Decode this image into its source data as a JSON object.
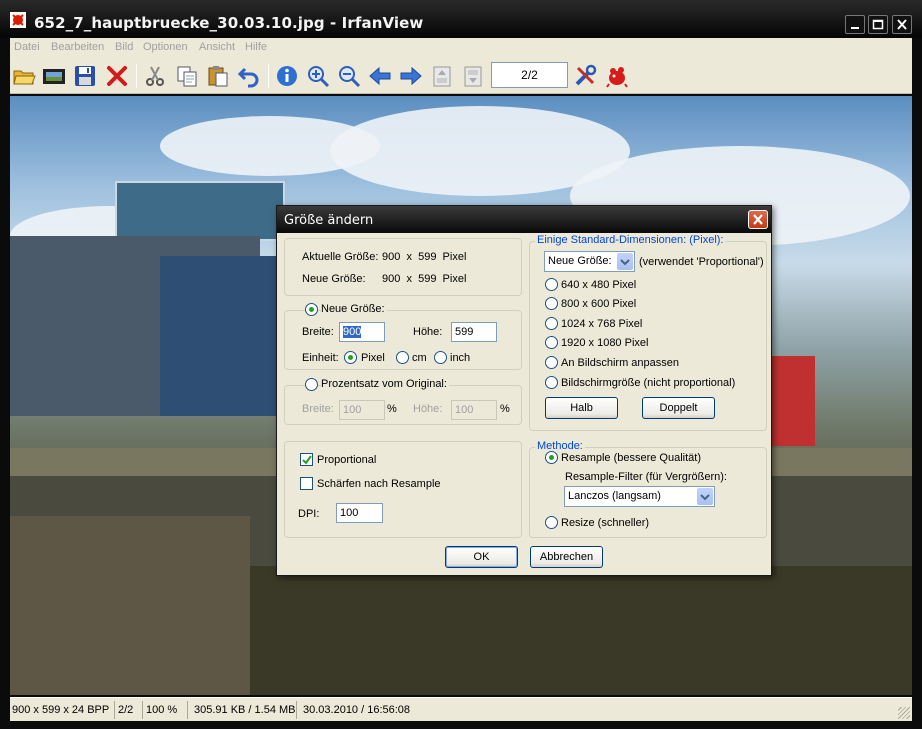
{
  "window": {
    "title": "652_7_hauptbruecke_30.03.10.jpg - IrfanView"
  },
  "menu": [
    "Datei",
    "Bearbeiten",
    "Bild",
    "Optionen",
    "Ansicht",
    "Hilfe"
  ],
  "toolbar": {
    "page_value": "2/2"
  },
  "status": {
    "dimensions": "900 x 599 x 24 BPP",
    "page": "2/2",
    "zoom": "100 %",
    "size": "305.91 KB / 1.54 MB",
    "datetime": "30.03.2010 / 16:56:08"
  },
  "dialog": {
    "title": "Größe ändern",
    "current_size_label": "Aktuelle Größe:",
    "current_size_value": "900  x  599  Pixel",
    "new_size_label": "Neue Größe:",
    "new_size_value": "900  x  599  Pixel",
    "new_size_radio": "Neue Größe:",
    "width_label": "Breite:",
    "width_value": "900",
    "height_label": "Höhe:",
    "height_value": "599",
    "unit_label": "Einheit:",
    "unit_pixel": "Pixel",
    "unit_cm": "cm",
    "unit_inch": "inch",
    "percent_radio": "Prozentsatz vom Original:",
    "pct_width_label": "Breite:",
    "pct_width_value": "100",
    "pct_height_label": "Höhe:",
    "pct_height_value": "100",
    "pct_symbol": "%",
    "proportional": "Proportional",
    "sharpen": "Schärfen nach Resample",
    "dpi_label": "DPI:",
    "dpi_value": "100",
    "std_group": "Einige Standard-Dimensionen: (Pixel):",
    "std_combo": "Neue Größe:",
    "std_combo_note": "(verwendet 'Proportional')",
    "std_options": [
      "640 x 480 Pixel",
      "800 x 600 Pixel",
      "1024 x 768 Pixel",
      "1920 x 1080 Pixel",
      "An Bildschirm anpassen",
      "Bildschirmgröße (nicht proportional)"
    ],
    "half_button": "Halb",
    "double_button": "Doppelt",
    "method_group": "Methode:",
    "resample": "Resample (bessere Qualität)",
    "filter_label": "Resample-Filter (für Vergrößern):",
    "filter_value": "Lanczos (langsam)",
    "resize": "Resize (schneller)",
    "ok": "OK",
    "cancel": "Abbrechen"
  }
}
